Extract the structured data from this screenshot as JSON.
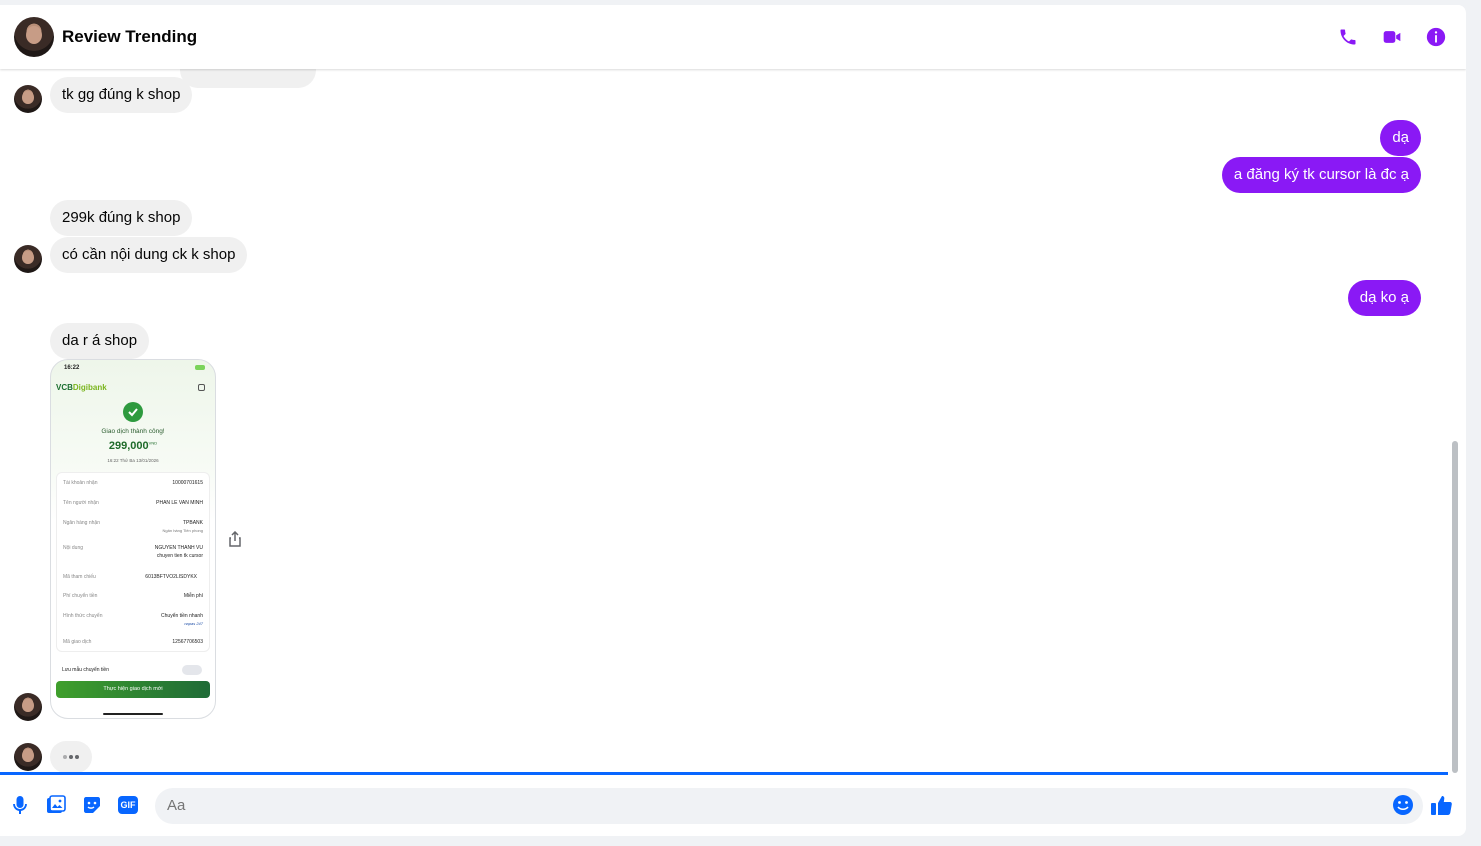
{
  "header": {
    "title": "Review Trending",
    "actions": [
      "phone-icon",
      "video-call-icon",
      "info-icon"
    ]
  },
  "colors": {
    "accent": "#8a19f5",
    "incoming": "#f0f0f0",
    "divider": "#0866ff",
    "composer_icons": "#0866ff"
  },
  "messages": [
    {
      "dir": "in",
      "text": "tk gg đúng k shop"
    },
    {
      "dir": "out",
      "text": "dạ"
    },
    {
      "dir": "out",
      "text": "a đăng ký tk cursor là đc ạ"
    },
    {
      "dir": "in",
      "text": "299k đúng k shop"
    },
    {
      "dir": "in",
      "text": "có cần nội dung ck k shop"
    },
    {
      "dir": "out",
      "text": "dạ ko ạ"
    },
    {
      "dir": "in",
      "text": "da r á shop"
    }
  ],
  "receipt": {
    "time": "16:22",
    "brand_vcb": "VCB",
    "brand_digi": "Digibank",
    "status": "Giao dịch thành công!",
    "amount": "299,000",
    "currency": "VND",
    "datetime": "16:22 Thứ Ba 13/01/2026",
    "rows": [
      {
        "label": "Tài khoản nhận",
        "value": "10000701615"
      },
      {
        "label": "Tên người nhận",
        "value": "PHAN LE VAN MINH"
      },
      {
        "label": "Ngân hàng nhận",
        "value": "TPBANK",
        "sub": "Ngân hàng Tiên phong"
      },
      {
        "label": "Nội dung",
        "value": "NGUYEN THANH VU",
        "sub": "chuyen tien tk cursor"
      },
      {
        "label": "Mã tham chiếu",
        "value": "6013BFTVO2LISDYKX"
      },
      {
        "label": "Phí chuyển tiền",
        "value": "Miễn phí"
      },
      {
        "label": "Hình thức chuyển",
        "value": "Chuyển tiền nhanh",
        "sub": "napas 247"
      },
      {
        "label": "Mã giao dịch",
        "value": "12567706503"
      }
    ],
    "save_label": "Lưu mẫu chuyển tiền",
    "new_tx_button": "Thực hiện giao dịch mới"
  },
  "composer": {
    "placeholder": "Aa",
    "icons": [
      "microphone-icon",
      "image-icon",
      "sticker-icon",
      "gif-icon",
      "emoji-icon",
      "like-icon"
    ],
    "gif_label": "GIF"
  }
}
